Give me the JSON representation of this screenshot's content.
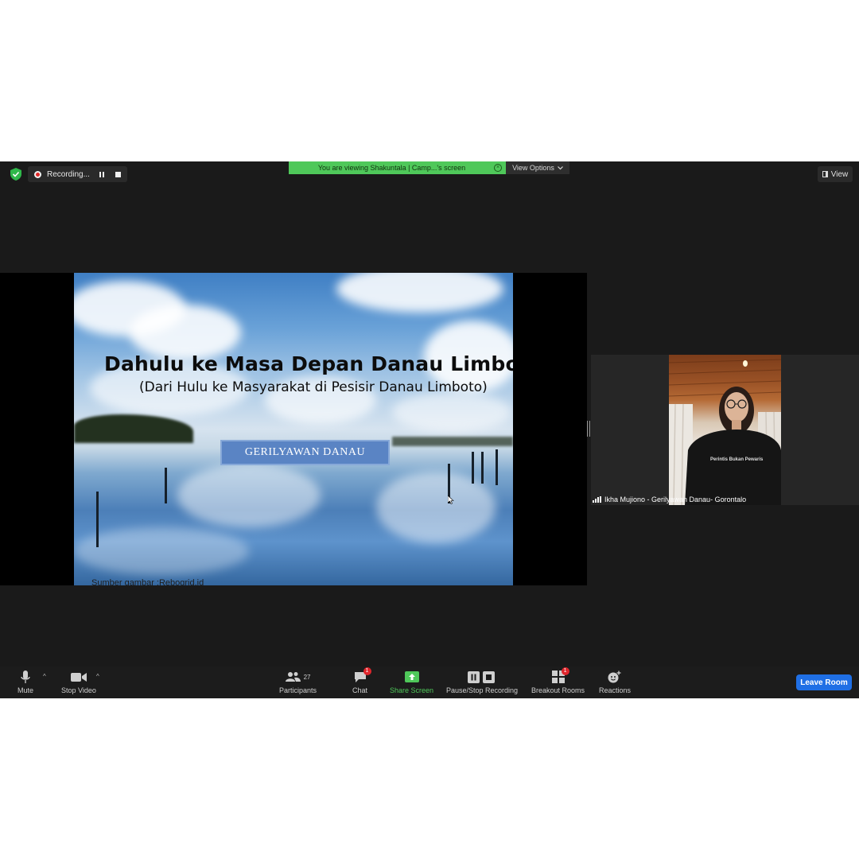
{
  "top_bar": {
    "recording_label": "Recording...",
    "viewing_banner": "You are viewing Shakuntala | Camp...'s screen",
    "view_options_label": "View Options",
    "view_label": "View"
  },
  "slide": {
    "title": "Dahulu ke Masa Depan Danau Limboto",
    "subtitle": "(Dari Hulu ke Masyarakat di Pesisir Danau Limboto)",
    "badge": "GERILYAWAN DANAU",
    "source": "Sumber gambar :Rebogrid.id"
  },
  "participant": {
    "name": "Ikha Mujiono - Gerilyawan Danau- Gorontalo"
  },
  "toolbar": {
    "mute_label": "Mute",
    "stop_video_label": "Stop Video",
    "participants_label": "Participants",
    "participants_count": "27",
    "chat_label": "Chat",
    "chat_badge": "1",
    "share_screen_label": "Share Screen",
    "recording_label": "Pause/Stop Recording",
    "breakout_label": "Breakout Rooms",
    "breakout_badge": "1",
    "reactions_label": "Reactions",
    "leave_label": "Leave Room"
  },
  "colors": {
    "share_green": "#4fc85a",
    "leave_blue": "#1f6fe5",
    "badge_red": "#e0262c"
  }
}
